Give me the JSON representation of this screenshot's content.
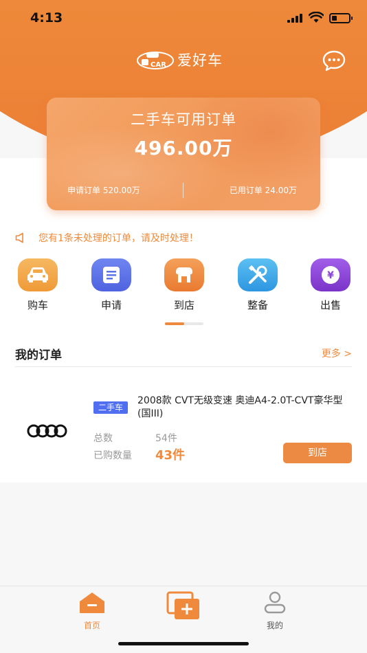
{
  "status_bar": {
    "time": "4:13"
  },
  "app": {
    "name": "爱好车",
    "logo_text": "CAR"
  },
  "balance_card": {
    "title": "二手车可用订单",
    "amount": "496.00万",
    "applied_label": "申请订单 520.00万",
    "used_label": "已用订单 24.00万"
  },
  "notice": {
    "text": "您有1条未处理的订单，请及时处理！"
  },
  "quick_nav": [
    {
      "label": "购车",
      "icon": "car-icon",
      "color": "#f2a848"
    },
    {
      "label": "申请",
      "icon": "form-icon",
      "color": "#5b73e8"
    },
    {
      "label": "到店",
      "icon": "store-icon",
      "color": "#ef8a3c"
    },
    {
      "label": "整备",
      "icon": "tools-icon",
      "color": "#3aa6e8"
    },
    {
      "label": "出售",
      "icon": "yen-icon",
      "color": "#8a45d6"
    }
  ],
  "orders": {
    "title": "我的订单",
    "more": "更多 >",
    "items": [
      {
        "brand_icon": "audi-logo",
        "tag": "二手车",
        "name": "2008款 CVT无级变速 奥迪A4-2.0T-CVT豪华型(国III)",
        "total_label": "总数",
        "total_value": "54件",
        "bought_label": "已购数量",
        "bought_value": "43件",
        "action": "到店"
      }
    ]
  },
  "tab_bar": [
    {
      "label": "首页",
      "icon": "home-icon",
      "active": true
    },
    {
      "label": "",
      "icon": "add-icon",
      "active": false
    },
    {
      "label": "我的",
      "icon": "user-icon",
      "active": false
    }
  ],
  "colors": {
    "accent": "#ef8a3c",
    "tag_blue": "#4f6ef0"
  }
}
